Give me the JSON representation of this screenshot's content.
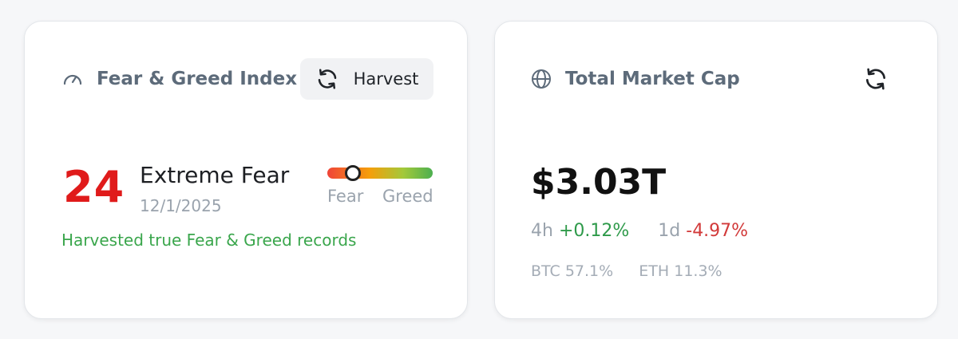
{
  "fear_greed": {
    "title": "Fear & Greed Index",
    "title_icon": "speedometer-icon",
    "harvest_button": {
      "label": "Harvest",
      "icon": "refresh-icon"
    },
    "value": "24",
    "classification": "Extreme Fear",
    "date": "12/1/2025",
    "gauge": {
      "low_label": "Fear",
      "high_label": "Greed",
      "level_percent": 24
    },
    "status": "Harvested true Fear & Greed records",
    "colors": {
      "value": "#e01b1b",
      "status": "#3aa64c"
    }
  },
  "market_cap": {
    "title": "Total Market Cap",
    "title_icon": "globe-icon",
    "refresh_icon": "refresh-icon",
    "value": "$3.03T",
    "change_4h": {
      "label": "4h",
      "value": "+0.12%"
    },
    "change_1d": {
      "label": "1d",
      "value": "-4.97%"
    },
    "dominance": {
      "btc": "BTC 57.1%",
      "eth": "ETH 11.3%"
    },
    "colors": {
      "positive": "#2e9a4a",
      "negative": "#d23a3a"
    }
  }
}
